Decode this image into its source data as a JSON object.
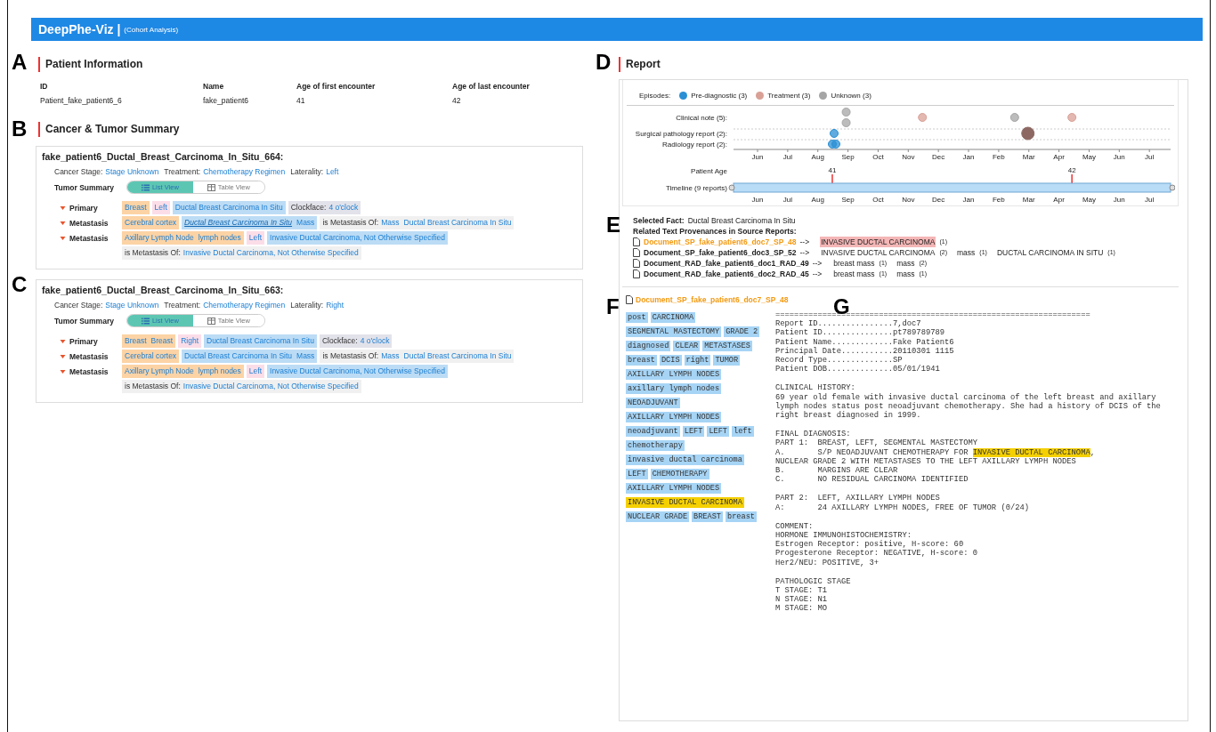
{
  "header": {
    "title": "DeepPhe-Viz |",
    "subtitle": "(Cohort Analysis)"
  },
  "figure_labels": [
    "A",
    "B",
    "C",
    "D",
    "E",
    "F",
    "G"
  ],
  "patient_information": {
    "title": "Patient Information",
    "fields": [
      {
        "label": "ID",
        "value": "Patient_fake_patient6_6"
      },
      {
        "label": "Name",
        "value": "fake_patient6"
      },
      {
        "label": "Age of first encounter",
        "value": "41"
      },
      {
        "label": "Age of last encounter",
        "value": "42"
      }
    ]
  },
  "cancer_summary": {
    "title": "Cancer & Tumor Summary",
    "cancers": [
      {
        "title": "fake_patient6_Ductal_Breast_Carcinoma_In_Situ_664:",
        "attributes": [
          {
            "label": "Cancer Stage:",
            "value": "Stage Unknown"
          },
          {
            "label": "Treatment:",
            "value": "Chemotherapy Regimen"
          },
          {
            "label": "Laterality:",
            "value": "Left"
          }
        ],
        "tumor_summary_label": "Tumor Summary",
        "views": [
          {
            "label": "List View",
            "kind": "list",
            "selected": true
          },
          {
            "label": "Table View",
            "kind": "table",
            "selected": false
          }
        ],
        "tumors": [
          {
            "type": "Primary",
            "expanded": true,
            "lines": [
              [
                {
                  "kind": "site",
                  "terms": [
                    {
                      "text": "Breast",
                      "selected": false
                    }
                  ]
                },
                {
                  "kind": "laterality",
                  "terms": [
                    {
                      "text": "Left",
                      "selected": false
                    }
                  ]
                },
                {
                  "kind": "diagnosis",
                  "terms": [
                    {
                      "text": "Ductal Breast Carcinoma In Situ",
                      "selected": false
                    }
                  ]
                },
                {
                  "kind": "attribute",
                  "label": "Clockface:",
                  "terms": [
                    {
                      "text": "4 o'clock",
                      "selected": false
                    }
                  ]
                }
              ]
            ]
          },
          {
            "type": "Metastasis",
            "expanded": true,
            "lines": [
              [
                {
                  "kind": "site",
                  "terms": [
                    {
                      "text": "Cerebral cortex",
                      "selected": false
                    }
                  ]
                },
                {
                  "kind": "diagnosis",
                  "terms": [
                    {
                      "text": "Ductal Breast Carcinoma In Situ",
                      "selected": true
                    },
                    {
                      "text": "Mass",
                      "selected": false
                    }
                  ]
                },
                {
                  "kind": "relation",
                  "label": "is Metastasis Of:",
                  "terms": [
                    {
                      "text": "Mass",
                      "selected": false
                    },
                    {
                      "text": "Ductal Breast Carcinoma In Situ",
                      "selected": false
                    }
                  ]
                }
              ]
            ]
          },
          {
            "type": "Metastasis",
            "expanded": true,
            "lines": [
              [
                {
                  "kind": "site",
                  "terms": [
                    {
                      "text": "Axillary Lymph Node",
                      "selected": false
                    },
                    {
                      "text": "lymph nodes",
                      "selected": false
                    }
                  ]
                },
                {
                  "kind": "laterality",
                  "terms": [
                    {
                      "text": "Left",
                      "selected": false
                    }
                  ]
                },
                {
                  "kind": "diagnosis",
                  "terms": [
                    {
                      "text": "Invasive Ductal Carcinoma, Not Otherwise Specified",
                      "selected": false
                    }
                  ]
                }
              ],
              [
                {
                  "kind": "relation",
                  "label": "is Metastasis Of:",
                  "terms": [
                    {
                      "text": "Invasive Ductal Carcinoma, Not Otherwise Specified",
                      "selected": false
                    }
                  ]
                }
              ]
            ]
          }
        ]
      },
      {
        "title": "fake_patient6_Ductal_Breast_Carcinoma_In_Situ_663:",
        "attributes": [
          {
            "label": "Cancer Stage:",
            "value": "Stage Unknown"
          },
          {
            "label": "Treatment:",
            "value": "Chemotherapy Regimen"
          },
          {
            "label": "Laterality:",
            "value": "Right"
          }
        ],
        "tumor_summary_label": "Tumor Summary",
        "views": [
          {
            "label": "List View",
            "kind": "list",
            "selected": true
          },
          {
            "label": "Table View",
            "kind": "table",
            "selected": false
          }
        ],
        "tumors": [
          {
            "type": "Primary",
            "expanded": true,
            "lines": [
              [
                {
                  "kind": "site",
                  "terms": [
                    {
                      "text": "Breast",
                      "selected": false
                    },
                    {
                      "text": "Breast",
                      "selected": false
                    }
                  ]
                },
                {
                  "kind": "laterality",
                  "terms": [
                    {
                      "text": "Right",
                      "selected": false
                    }
                  ]
                },
                {
                  "kind": "diagnosis",
                  "terms": [
                    {
                      "text": "Ductal Breast Carcinoma In Situ",
                      "selected": false
                    }
                  ]
                },
                {
                  "kind": "attribute",
                  "label": "Clockface:",
                  "terms": [
                    {
                      "text": "4 o'clock",
                      "selected": false
                    }
                  ]
                }
              ]
            ]
          },
          {
            "type": "Metastasis",
            "expanded": true,
            "lines": [
              [
                {
                  "kind": "site",
                  "terms": [
                    {
                      "text": "Cerebral cortex",
                      "selected": false
                    }
                  ]
                },
                {
                  "kind": "diagnosis",
                  "terms": [
                    {
                      "text": "Ductal Breast Carcinoma In Situ",
                      "selected": false
                    },
                    {
                      "text": "Mass",
                      "selected": false
                    }
                  ]
                },
                {
                  "kind": "relation",
                  "label": "is Metastasis Of:",
                  "terms": [
                    {
                      "text": "Mass",
                      "selected": false
                    },
                    {
                      "text": "Ductal Breast Carcinoma In Situ",
                      "selected": false
                    }
                  ]
                }
              ]
            ]
          },
          {
            "type": "Metastasis",
            "expanded": true,
            "lines": [
              [
                {
                  "kind": "site",
                  "terms": [
                    {
                      "text": "Axillary Lymph Node",
                      "selected": false
                    },
                    {
                      "text": "lymph nodes",
                      "selected": false
                    }
                  ]
                },
                {
                  "kind": "laterality",
                  "terms": [
                    {
                      "text": "Left",
                      "selected": false
                    }
                  ]
                },
                {
                  "kind": "diagnosis",
                  "terms": [
                    {
                      "text": "Invasive Ductal Carcinoma, Not Otherwise Specified",
                      "selected": false
                    }
                  ]
                }
              ],
              [
                {
                  "kind": "relation",
                  "label": "is Metastasis Of:",
                  "terms": [
                    {
                      "text": "Invasive Ductal Carcinoma, Not Otherwise Specified",
                      "selected": false
                    }
                  ]
                }
              ]
            ]
          }
        ]
      }
    ]
  },
  "report": {
    "title": "Report",
    "legend": {
      "label": "Episodes:",
      "items": [
        {
          "label": "Pre-diagnostic (3)",
          "color": "#2a8fd4"
        },
        {
          "label": "Treatment (3)",
          "color": "#d9a096"
        },
        {
          "label": "Unknown (3)",
          "color": "#a5a5a5"
        }
      ]
    },
    "episodes": {
      "rows": [
        {
          "label": "Clinical note (5):"
        },
        {
          "label": "Surgical pathology report (2):"
        },
        {
          "label": "Radiology report (2):"
        }
      ],
      "months": [
        "Jun",
        "Jul",
        "Aug",
        "Sep",
        "Oct",
        "Nov",
        "Dec",
        "Jan",
        "Feb",
        "Mar",
        "Apr",
        "May",
        "Jun",
        "Jul"
      ]
    },
    "timeline": {
      "age_label": "Patient Age",
      "age_markers": [
        "41",
        "42"
      ],
      "label": "Timeline (9 reports)",
      "ticks": [
        "Jun",
        "Jul",
        "Aug",
        "Sep",
        "Oct",
        "Nov",
        "Dec",
        "Jan",
        "Feb",
        "Mar",
        "Apr",
        "May",
        "Jun",
        "Jul"
      ]
    },
    "selected_fact": {
      "label": "Selected Fact:",
      "value": "Ductal Breast Carcinoma In Situ"
    },
    "provenance": {
      "title": "Related Text Provenances in Source Reports:",
      "documents": [
        {
          "name": "Document_SP_fake_patient6_doc7_SP_48",
          "selected": true,
          "arrow": "-->",
          "terms": [
            {
              "text": "INVASIVE DUCTAL CARCINOMA",
              "count": "(1)",
              "highlighted": true
            }
          ]
        },
        {
          "name": "Document_SP_fake_patient6_doc3_SP_52",
          "selected": false,
          "arrow": "-->",
          "terms": [
            {
              "text": "INVASIVE DUCTAL CARCINOMA",
              "count": "(2)",
              "highlighted": false
            },
            {
              "text": "mass",
              "count": "(1)",
              "highlighted": false
            },
            {
              "text": "DUCTAL CARCINOMA IN SITU",
              "count": "(1)",
              "highlighted": false
            }
          ]
        },
        {
          "name": "Document_RAD_fake_patient6_doc1_RAD_49",
          "selected": false,
          "arrow": "-->",
          "terms": [
            {
              "text": "breast mass",
              "count": "(1)",
              "highlighted": false
            },
            {
              "text": "mass",
              "count": "(2)",
              "highlighted": false
            }
          ]
        },
        {
          "name": "Document_RAD_fake_patient6_doc2_RAD_45",
          "selected": false,
          "arrow": "-->",
          "terms": [
            {
              "text": "breast mass",
              "count": "(1)",
              "highlighted": false
            },
            {
              "text": "mass",
              "count": "(1)",
              "highlighted": false
            }
          ]
        }
      ]
    },
    "document": {
      "name": "Document_SP_fake_patient6_doc7_SP_48",
      "term_lines": [
        [
          {
            "text": "post",
            "highlighted": false
          },
          {
            "text": "CARCINOMA",
            "highlighted": false
          }
        ],
        [
          {
            "text": "SEGMENTAL MASTECTOMY",
            "highlighted": false
          },
          {
            "text": "GRADE 2",
            "highlighted": false
          }
        ],
        [
          {
            "text": "diagnosed",
            "highlighted": false
          },
          {
            "text": "CLEAR",
            "highlighted": false
          },
          {
            "text": "METASTASES",
            "highlighted": false
          }
        ],
        [
          {
            "text": "breast",
            "highlighted": false
          },
          {
            "text": "DCIS",
            "highlighted": false
          },
          {
            "text": "right",
            "highlighted": false
          },
          {
            "text": "TUMOR",
            "highlighted": false
          }
        ],
        [
          {
            "text": "AXILLARY LYMPH NODES",
            "highlighted": false
          }
        ],
        [
          {
            "text": "axillary lymph nodes",
            "highlighted": false
          }
        ],
        [
          {
            "text": "NEOADJUVANT",
            "highlighted": false
          }
        ],
        [
          {
            "text": "AXILLARY LYMPH NODES",
            "highlighted": false
          }
        ],
        [
          {
            "text": "neoadjuvant",
            "highlighted": false
          },
          {
            "text": "LEFT",
            "highlighted": false
          },
          {
            "text": "LEFT",
            "highlighted": false
          },
          {
            "text": "left",
            "highlighted": false
          }
        ],
        [
          {
            "text": "chemotherapy",
            "highlighted": false
          }
        ],
        [
          {
            "text": "invasive ductal carcinoma",
            "highlighted": false
          }
        ],
        [
          {
            "text": "LEFT",
            "highlighted": false
          },
          {
            "text": "CHEMOTHERAPY",
            "highlighted": false
          }
        ],
        [
          {
            "text": "AXILLARY LYMPH NODES",
            "highlighted": false
          }
        ],
        [
          {
            "text": "INVASIVE DUCTAL CARCINOMA",
            "highlighted": true
          }
        ],
        [
          {
            "text": "NUCLEAR GRADE",
            "highlighted": false
          },
          {
            "text": "BREAST",
            "highlighted": false
          },
          {
            "text": "breast",
            "highlighted": false
          }
        ]
      ],
      "report_blocks": [
        [
          "===================================================================",
          "Report ID................7,doc7",
          "Patient ID...............pt789789789",
          "Patient Name.............Fake Patient6",
          "Principal Date...........20110301 1115",
          "Record Type..............SP",
          "Patient DOB..............05/01/1941"
        ],
        [
          "CLINICAL HISTORY:",
          "69 year old female with invasive ductal carcinoma of the left breast and axillary",
          "lymph nodes status post neoadjuvant chemotherapy. She had a history of DCIS of the",
          "right breast diagnosed in 1999."
        ],
        [
          "FINAL DIAGNOSIS:",
          "PART 1:  BREAST, LEFT, SEGMENTAL MASTECTOMY",
          {
            "text": "A.       S/P NEOADJUVANT CHEMOTHERAPY FOR ",
            "mark": "INVASIVE DUCTAL CARCINOMA",
            "rest": ","
          },
          "NUCLEAR GRADE 2 WITH METASTASES TO THE LEFT AXILLARY LYMPH NODES",
          "B.       MARGINS ARE CLEAR",
          "C.       NO RESIDUAL CARCINOMA IDENTIFIED"
        ],
        [
          "PART 2:  LEFT, AXILLARY LYMPH NODES",
          "A:       24 AXILLARY LYMPH NODES, FREE OF TUMOR (0/24)"
        ],
        [
          "COMMENT:",
          "HORMONE IMMUNOHISTOCHEMISTRY:",
          "Estrogen Receptor: positive, H-score: 60",
          "Progesterone Receptor: NEGATIVE, H-score: 0",
          "Her2/NEU: POSITIVE, 3+"
        ],
        [
          "PATHOLOGIC STAGE",
          "T STAGE: T1",
          "N STAGE: N1",
          "M STAGE: MO"
        ]
      ]
    }
  }
}
